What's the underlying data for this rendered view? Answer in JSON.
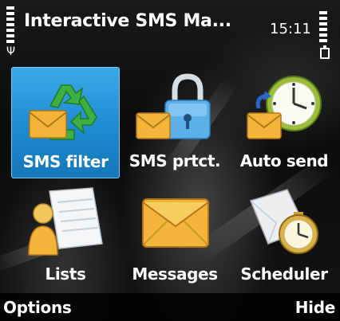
{
  "status_bar": {
    "title": "Interactive SMS Ma...",
    "time": "15:11"
  },
  "grid": {
    "items": [
      {
        "label": "SMS filter",
        "icon": "recycle-envelope-icon",
        "selected": true
      },
      {
        "label": "SMS prtct.",
        "icon": "padlock-envelope-icon",
        "selected": false
      },
      {
        "label": "Auto send",
        "icon": "clock-envelope-icon",
        "selected": false
      },
      {
        "label": "Lists",
        "icon": "contact-list-icon",
        "selected": false
      },
      {
        "label": "Messages",
        "icon": "envelope-icon",
        "selected": false
      },
      {
        "label": "Scheduler",
        "icon": "stopwatch-icon",
        "selected": false
      }
    ]
  },
  "softkeys": {
    "left": "Options",
    "right": "Hide"
  },
  "colors": {
    "selection": "#1c88cf",
    "envelope": "#f2b53a",
    "recycle": "#3cb043",
    "lock": "#5ab0e8"
  }
}
